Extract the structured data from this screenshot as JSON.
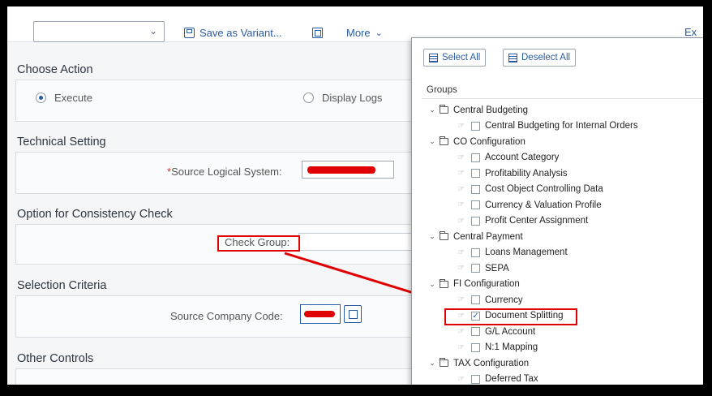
{
  "toolbar": {
    "variant_value": "",
    "save_variant_label": "Save as Variant...",
    "more_label": "More",
    "edge_text": "Ex"
  },
  "choose_action": {
    "title": "Choose Action",
    "execute_label": "Execute",
    "execute_selected": true,
    "display_logs_label": "Display Logs"
  },
  "technical_setting": {
    "title": "Technical Setting",
    "source_logical_system_label": "Source Logical System:"
  },
  "consistency_check": {
    "title": "Option for Consistency Check",
    "check_group_label": "Check Group:"
  },
  "selection_criteria": {
    "title": "Selection Criteria",
    "source_company_code_label": "Source Company Code:"
  },
  "other_controls": {
    "title": "Other Controls"
  },
  "dropdown": {
    "select_all_label": "Select All",
    "deselect_all_label": "Deselect All",
    "groups_header": "Groups",
    "tree": [
      {
        "type": "group",
        "label": "Central Budgeting"
      },
      {
        "type": "item",
        "label": "Central Budgeting for Internal Orders",
        "checked": false
      },
      {
        "type": "group",
        "label": "CO Configuration"
      },
      {
        "type": "item",
        "label": "Account Category",
        "checked": false
      },
      {
        "type": "item",
        "label": "Profitability Analysis",
        "checked": false
      },
      {
        "type": "item",
        "label": "Cost Object Controlling Data",
        "checked": false
      },
      {
        "type": "item",
        "label": "Currency & Valuation Profile",
        "checked": false
      },
      {
        "type": "item",
        "label": "Profit Center Assignment",
        "checked": false
      },
      {
        "type": "group",
        "label": "Central Payment"
      },
      {
        "type": "item",
        "label": "Loans Management",
        "checked": false
      },
      {
        "type": "item",
        "label": "SEPA",
        "checked": false
      },
      {
        "type": "group",
        "label": "FI Configuration"
      },
      {
        "type": "item",
        "label": "Currency",
        "checked": false
      },
      {
        "type": "item",
        "label": "Document Splitting",
        "checked": true
      },
      {
        "type": "item",
        "label": "G/L Account",
        "checked": false
      },
      {
        "type": "item",
        "label": "N:1 Mapping",
        "checked": false
      },
      {
        "type": "group",
        "label": "TAX Configuration"
      },
      {
        "type": "item",
        "label": "Deferred Tax",
        "checked": false
      }
    ]
  },
  "colors": {
    "accent": "#2a5ba5",
    "highlight": "#e00000"
  }
}
